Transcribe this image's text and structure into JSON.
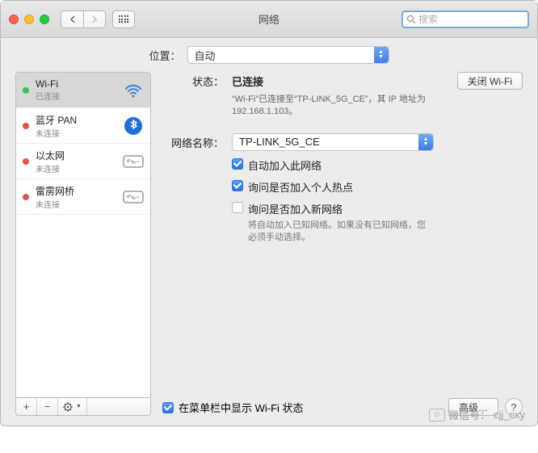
{
  "window": {
    "title": "网络"
  },
  "search": {
    "placeholder": "搜索"
  },
  "location": {
    "label": "位置：",
    "value": "自动"
  },
  "sidebar": {
    "items": [
      {
        "name": "Wi-Fi",
        "status": "已连接",
        "status_color": "green",
        "icon": "wifi",
        "selected": true
      },
      {
        "name": "蓝牙 PAN",
        "status": "未连接",
        "status_color": "red",
        "icon": "bluetooth",
        "selected": false
      },
      {
        "name": "以太网",
        "status": "未连接",
        "status_color": "red",
        "icon": "ethernet",
        "selected": false
      },
      {
        "name": "雷雳网桥",
        "status": "未连接",
        "status_color": "red",
        "icon": "ethernet",
        "selected": false
      }
    ],
    "tools": {
      "add": "+",
      "remove": "−",
      "gear": "✻▾"
    }
  },
  "main": {
    "status_label": "状态：",
    "status_value": "已连接",
    "wifi_off_btn": "关闭 Wi-Fi",
    "status_desc": "“Wi-Fi”已连接至“TP-LINK_5G_CE”，其 IP 地址为 192.168.1.103。",
    "network_label": "网络名称：",
    "network_value": "TP-LINK_5G_CE",
    "checks": [
      {
        "label": "自动加入此网络",
        "checked": true
      },
      {
        "label": "询问是否加入个人热点",
        "checked": true
      },
      {
        "label": "询问是否加入新网络",
        "checked": false,
        "desc": "将自动加入已知网络。如果没有已知网络，您必须手动选择。"
      }
    ],
    "menubar_check": {
      "label": "在菜单栏中显示 Wi-Fi 状态",
      "checked": true
    },
    "advanced_btn": "高级…",
    "help": "?"
  },
  "watermark": {
    "label": "微信号：",
    "value": "cjj_cxy"
  }
}
